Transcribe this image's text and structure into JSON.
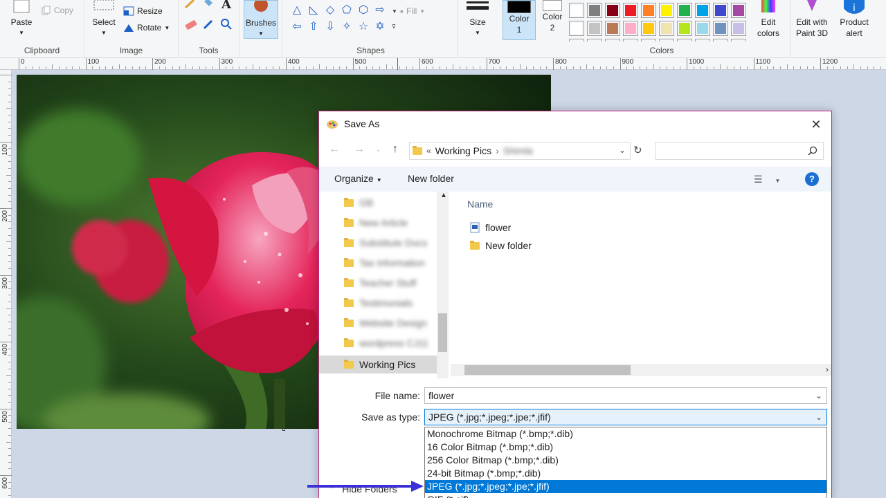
{
  "ribbon": {
    "clipboard": {
      "label": "Clipboard",
      "paste": "Paste",
      "copy": "Copy"
    },
    "image": {
      "label": "Image",
      "select": "Select",
      "resize": "Resize",
      "rotate": "Rotate"
    },
    "tools": {
      "label": "Tools"
    },
    "brushes": {
      "label": "Brushes"
    },
    "shapes": {
      "label": "Shapes",
      "fill": "Fill"
    },
    "size": {
      "label": "Size"
    },
    "color1": {
      "label_line1": "Color",
      "label_line2": "1"
    },
    "color2": {
      "label_line1": "Color",
      "label_line2": "2"
    },
    "colors": {
      "label": "Colors",
      "row1": [
        "#ffffff",
        "#7f7f7f",
        "#880015",
        "#ed1c24",
        "#ff7f27",
        "#fff200",
        "#22b14c",
        "#00a2e8",
        "#3f48cc",
        "#a349a4"
      ],
      "row2": [
        "#ffffff",
        "#c3c3c3",
        "#b97a57",
        "#ffaec9",
        "#ffc90e",
        "#efe4b0",
        "#b5e61d",
        "#99d9ea",
        "#7092be",
        "#c8bfe7"
      ]
    },
    "edit_colors": {
      "line1": "Edit",
      "line2": "colors"
    },
    "edit_paint3d": {
      "line1": "Edit with",
      "line2": "Paint 3D"
    },
    "product_alert": {
      "line1": "Product",
      "line2": "alert"
    }
  },
  "rulers": {
    "horizontal": [
      "0",
      "100",
      "200",
      "300",
      "400",
      "500",
      "600",
      "700",
      "800",
      "900",
      "1000",
      "1100",
      "1200"
    ],
    "vertical": [
      "100",
      "200",
      "300",
      "400",
      "500",
      "600"
    ]
  },
  "dialog": {
    "title": "Save As",
    "breadcrumb_sep": "«",
    "breadcrumb_folder": "Working Pics",
    "breadcrumb_sub": "Shimla",
    "organize": "Organize",
    "new_folder": "New folder",
    "help": "?",
    "tree": [
      {
        "label": "GB",
        "blurred": true
      },
      {
        "label": "New Article",
        "blurred": true
      },
      {
        "label": "Substitute Docs",
        "blurred": true
      },
      {
        "label": "Tax information",
        "blurred": true
      },
      {
        "label": "Teacher Stuff",
        "blurred": true
      },
      {
        "label": "Testimonials",
        "blurred": true
      },
      {
        "label": "Website Design",
        "blurred": true
      },
      {
        "label": "wordpress CJ11",
        "blurred": true
      },
      {
        "label": "Working Pics",
        "blurred": false
      }
    ],
    "column_name": "Name",
    "files": [
      {
        "name": "flower",
        "icon": "image-file-icon"
      },
      {
        "name": "New folder",
        "icon": "folder-icon"
      }
    ],
    "file_name_label": "File name:",
    "file_name_value": "flower",
    "save_type_label": "Save as type:",
    "save_type_value": "JPEG (*.jpg;*.jpeg;*.jpe;*.jfif)",
    "type_options": [
      {
        "label": "Monochrome Bitmap (*.bmp;*.dib)",
        "selected": false
      },
      {
        "label": "16 Color Bitmap (*.bmp;*.dib)",
        "selected": false
      },
      {
        "label": "256 Color Bitmap (*.bmp;*.dib)",
        "selected": false
      },
      {
        "label": "24-bit Bitmap (*.bmp;*.dib)",
        "selected": false
      },
      {
        "label": "JPEG (*.jpg;*.jpeg;*.jpe;*.jfif)",
        "selected": true
      },
      {
        "label": "GIF (*.gif)",
        "selected": false
      }
    ],
    "hide_folders": "Hide Folders"
  },
  "colors": {
    "accent": "#0078d7",
    "dialog_border": "#c4257e",
    "annotation_arrow": "#3b2fd8"
  }
}
